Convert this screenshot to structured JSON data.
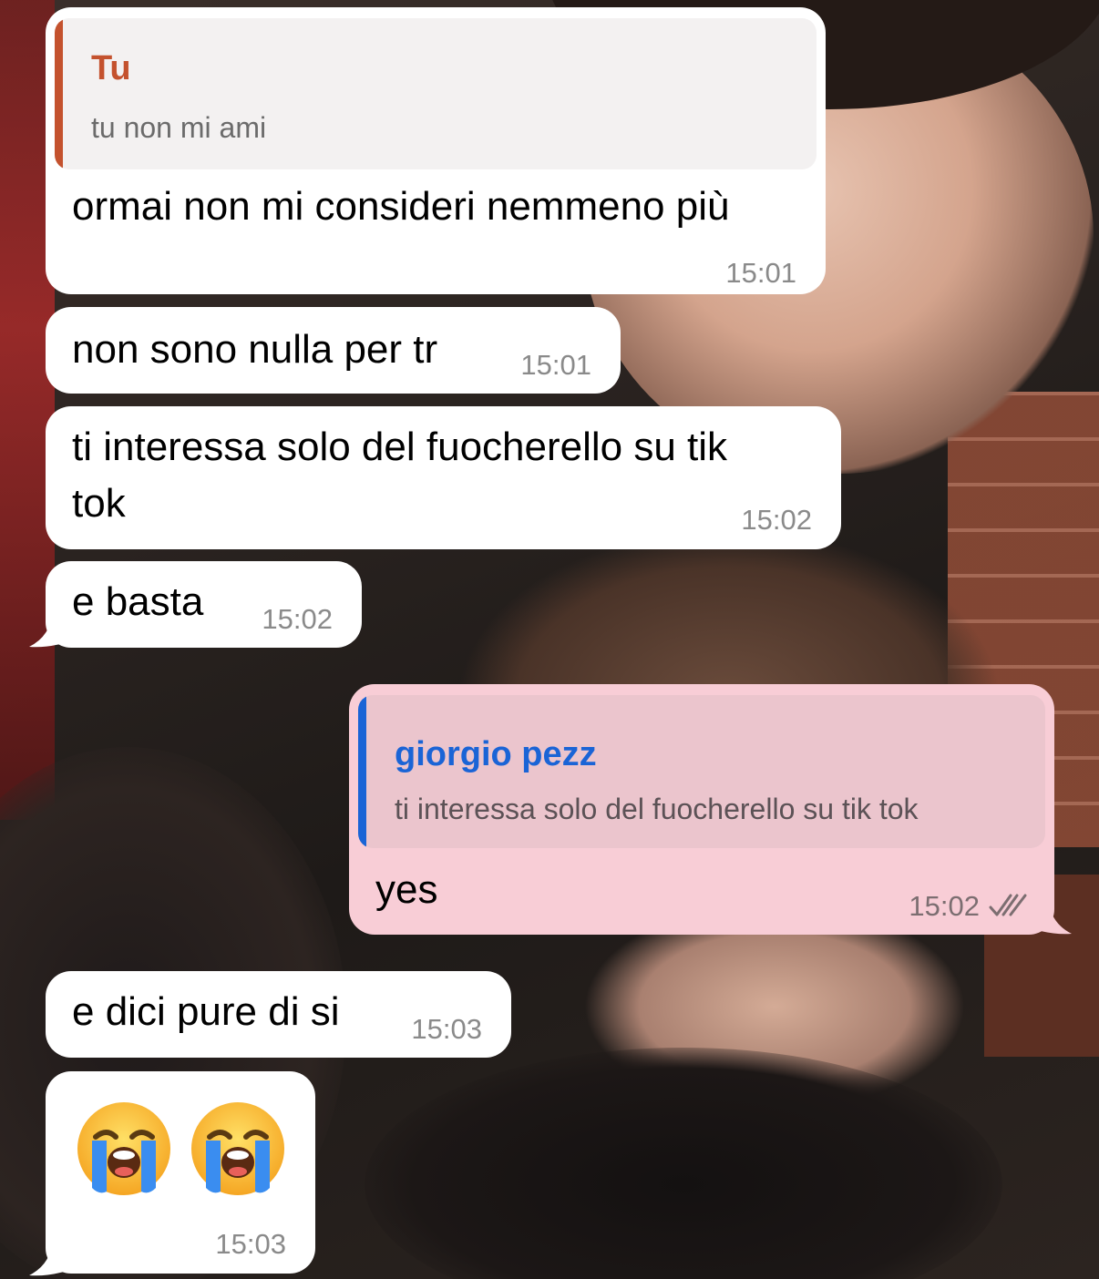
{
  "messages": [
    {
      "direction": "incoming",
      "quote": {
        "name": "Tu",
        "text": "tu non mi ami",
        "accent": "#c4522e"
      },
      "text": "ormai non mi consideri nemmeno più",
      "time": "15:01"
    },
    {
      "direction": "incoming",
      "text": "non sono nulla per tr",
      "time": "15:01"
    },
    {
      "direction": "incoming",
      "text_lines": [
        "ti interessa solo del fuocherello su tik",
        "tok"
      ],
      "time": "15:02"
    },
    {
      "direction": "incoming",
      "text": "e basta",
      "time": "15:02"
    },
    {
      "direction": "outgoing",
      "quote": {
        "name": "giorgio pezz",
        "text": "ti interessa solo del fuocherello su tik tok",
        "accent": "#1a64d6"
      },
      "text": "yes",
      "time": "15:02",
      "status_icon": "double-check-read-icon"
    },
    {
      "direction": "incoming",
      "text": "e dici pure di si",
      "time": "15:03"
    },
    {
      "direction": "incoming",
      "emoji": [
        "loudly-crying-face-icon",
        "loudly-crying-face-icon"
      ],
      "time": "15:03"
    }
  ],
  "colors": {
    "incoming_bubble": "#ffffff",
    "outgoing_bubble": "#f8cdd6",
    "timestamp": "#8a8a8a"
  }
}
